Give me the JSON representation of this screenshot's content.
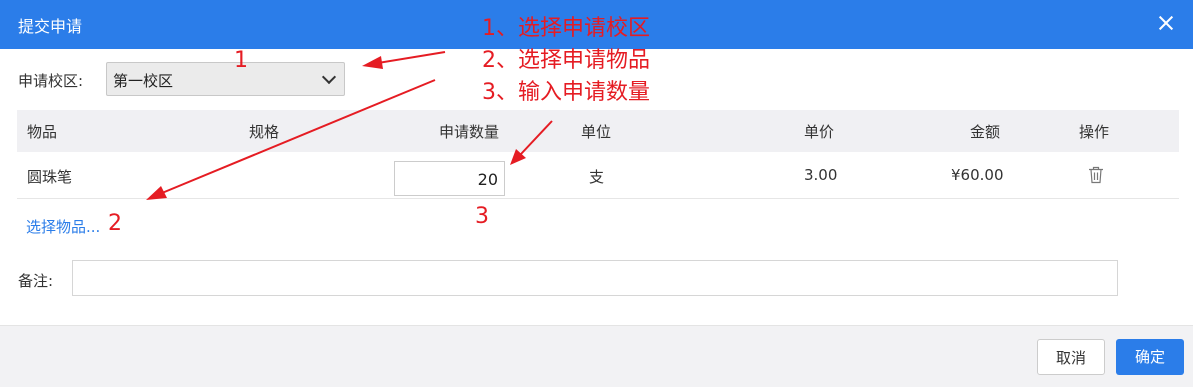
{
  "dialog": {
    "title": "提交申请"
  },
  "campus": {
    "label": "申请校区:",
    "selected": "第一校区"
  },
  "table": {
    "headers": {
      "item": "物品",
      "spec": "规格",
      "qty": "申请数量",
      "unit": "单位",
      "price": "单价",
      "amount": "金额",
      "op": "操作"
    },
    "rows": [
      {
        "item": "圆珠笔",
        "spec": "",
        "qty": "20",
        "unit": "支",
        "price": "3.00",
        "amount": "¥60.00"
      }
    ]
  },
  "choose_items_link": "选择物品...",
  "remark": {
    "label": "备注:",
    "value": ""
  },
  "footer": {
    "cancel": "取消",
    "confirm": "确定"
  },
  "annotations": {
    "step1": "1、选择申请校区",
    "step2": "2、选择申请物品",
    "step3": "3、输入申请数量",
    "mark1": "1",
    "mark2": "2",
    "mark3": "3"
  },
  "colors": {
    "primary": "#2b7de9",
    "annotation": "#e51c23"
  }
}
